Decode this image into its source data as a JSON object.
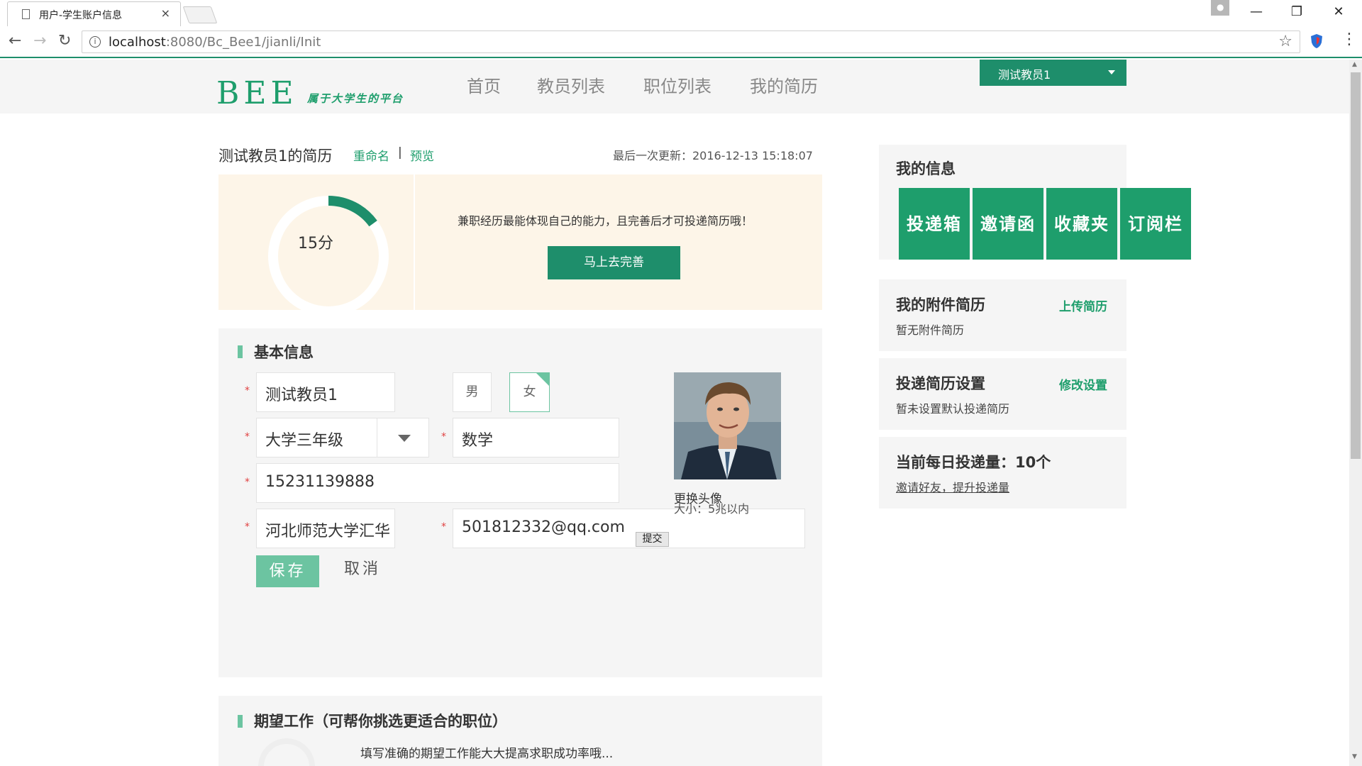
{
  "browser": {
    "tab_title": "用户-学生账户信息",
    "tab_close": "×",
    "url_host": "localhost",
    "url_rest": ":8080/Bc_Bee1/jianli/Init",
    "back": "←",
    "forward": "→",
    "reload": "↻",
    "star": "☆",
    "info": "i",
    "menu": "⋮",
    "window": {
      "minimize": "—",
      "restore": "❐",
      "close": "✕"
    }
  },
  "header": {
    "logo_text": "BEE",
    "logo_slogan": "属于大学生的平台",
    "nav": [
      "首页",
      "教员列表",
      "职位列表",
      "我的简历"
    ],
    "user_name": "测试教员1"
  },
  "resume": {
    "title": "测试教员1的简历",
    "rename": "重命名",
    "separator": "|",
    "preview": "预览",
    "last_update": "最后一次更新：2016-12-13 15:18:07",
    "score": "15分",
    "score_fraction": 0.15,
    "tip": "兼职经历最能体现自己的能力，且完善后才可投递简历哦！",
    "improve_button": "马上去完善"
  },
  "basic_info": {
    "section_title": "基本信息",
    "required_mark": "*",
    "name": "测试教员1",
    "gender_male": "男",
    "gender_female": "女",
    "gender_selected": "女",
    "grade": "大学三年级",
    "major": "数学",
    "phone": "15231139888",
    "school": "河北师范大学汇华学院",
    "email": "501812332@qq.com",
    "avatar_change": "更换头像",
    "avatar_size": "大小：5兆以内",
    "submit": "提交",
    "save": "保存",
    "cancel": "取消"
  },
  "job": {
    "section_title": "期望工作（可帮你挑选更适合的职位）",
    "tip": "填写准确的期望工作能大大提高求职成功率哦..."
  },
  "sidebar": {
    "my_info_title": "我的信息",
    "tiles": [
      "投递箱",
      "邀请函",
      "收藏夹",
      "订阅栏"
    ],
    "attachment_title": "我的附件简历",
    "upload": "上传简历",
    "no_attachment": "暂无附件简历",
    "delivery_title": "投递简历设置",
    "modify": "修改设置",
    "no_default": "暂未设置默认投递简历",
    "quota_title": "当前每日投递量：10个",
    "invite": "邀请好友，提升投递量"
  },
  "colors": {
    "brand": "#1e8e6b",
    "brand_light": "#6cc4a1",
    "score_bg": "#fdf5e8"
  }
}
